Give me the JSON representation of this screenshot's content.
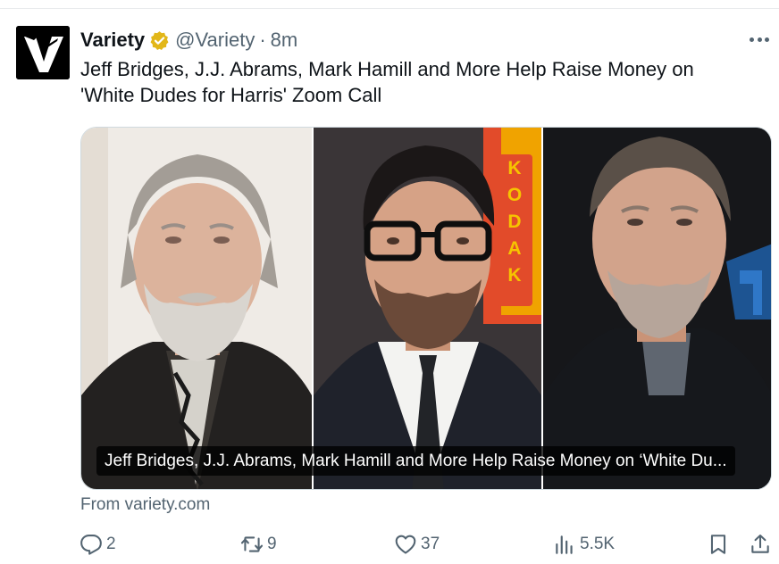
{
  "tweet": {
    "author_name": "Variety",
    "handle": "@Variety",
    "separator": "·",
    "time": "8m",
    "text": "Jeff Bridges, J.J. Abrams, Mark Hamill and More Help Raise Money on 'White Dudes for Harris' Zoom Call"
  },
  "icons": {
    "avatar": "variety-v-logo",
    "verified": "gold-verified-badge",
    "more": "more-dots-icon",
    "reply": "reply-icon",
    "retweet": "retweet-icon",
    "like": "heart-icon",
    "views": "views-bar-icon",
    "bookmark": "bookmark-icon",
    "share": "share-icon"
  },
  "colors": {
    "badge_gold": "#e2b719",
    "text_primary": "#0f1419",
    "text_secondary": "#536471",
    "border": "#cfd9de"
  },
  "card": {
    "caption": "Jeff Bridges, J.J. Abrams, Mark Hamill and More Help Raise Money on ‘White Du...",
    "source": "From variety.com",
    "kodak_letters": "KODAK"
  },
  "actions": {
    "replies": "2",
    "retweets": "9",
    "likes": "37",
    "views": "5.5K"
  }
}
